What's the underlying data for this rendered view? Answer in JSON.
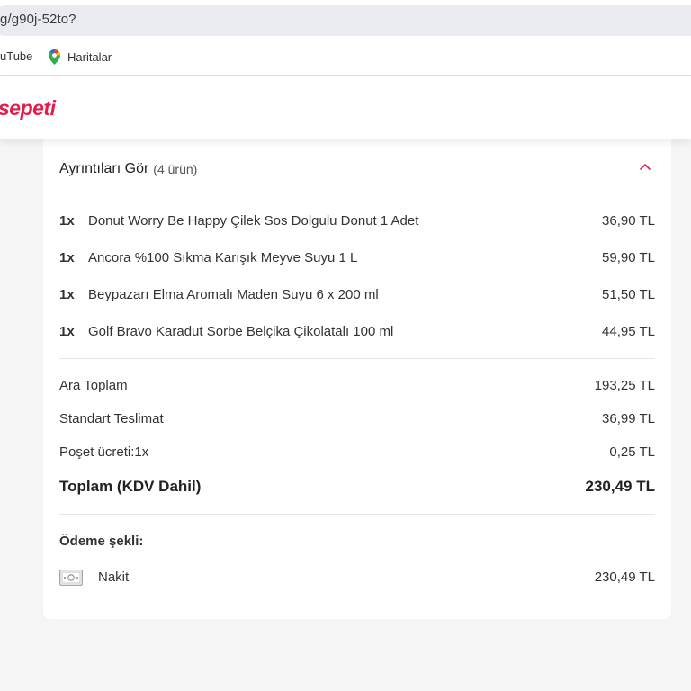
{
  "browser": {
    "url": "g/g90j-52to?",
    "bookmarks": [
      {
        "label": "uTube"
      },
      {
        "label": "Haritalar"
      }
    ]
  },
  "header": {
    "logo": "sepeti",
    "logo_color": "#e31c4b"
  },
  "details": {
    "title": "Ayrıntıları Gör",
    "count": "(4 ürün)",
    "items": [
      {
        "qty": "1x",
        "name": "Donut Worry Be Happy Çilek Sos Dolgulu Donut 1 Adet",
        "price": "36,90 TL"
      },
      {
        "qty": "1x",
        "name": "Ancora %100 Sıkma Karışık Meyve Suyu 1 L",
        "price": "59,90 TL"
      },
      {
        "qty": "1x",
        "name": "Beypazarı Elma Aromalı Maden Suyu 6 x 200 ml",
        "price": "51,50 TL"
      },
      {
        "qty": "1x",
        "name": "Golf Bravo Karadut Sorbe Belçika Çikolatalı 100 ml",
        "price": "44,95 TL"
      }
    ]
  },
  "summary": {
    "subtotal": {
      "label": "Ara Toplam",
      "value": "193,25 TL"
    },
    "delivery": {
      "label": "Standart Teslimat",
      "value": "36,99 TL"
    },
    "bag_fee": {
      "label": "Poşet ücreti:1x",
      "value": "0,25 TL"
    },
    "total": {
      "label": "Toplam (KDV Dahil)",
      "value": "230,49 TL"
    }
  },
  "payment": {
    "title": "Ödeme şekli:",
    "method": "Nakit",
    "amount": "230,49 TL",
    "icon": "cash-icon"
  }
}
